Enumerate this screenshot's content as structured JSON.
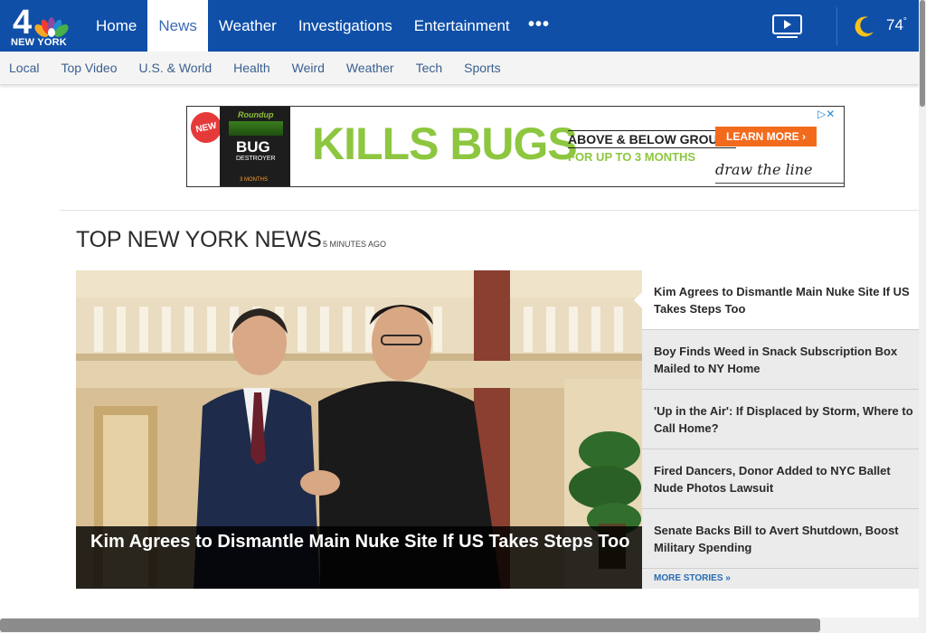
{
  "header": {
    "logo": {
      "number": "4",
      "city": "NEW YORK"
    },
    "nav": [
      {
        "label": "Home",
        "active": false
      },
      {
        "label": "News",
        "active": true
      },
      {
        "label": "Weather",
        "active": false
      },
      {
        "label": "Investigations",
        "active": false
      },
      {
        "label": "Entertainment",
        "active": false
      }
    ],
    "more_icon": "more-dots-icon",
    "video_icon": "video-play-icon",
    "weather": {
      "icon": "moon-icon",
      "temperature": "74",
      "unit": "°"
    }
  },
  "subnav": [
    "Local",
    "Top Video",
    "U.S. & World",
    "Health",
    "Weird",
    "Weather",
    "Tech",
    "Sports"
  ],
  "ad": {
    "badge": "NEW",
    "product_brand": "Roundup",
    "product_name": "BUG",
    "product_sub": "DESTROYER",
    "product_months": "3 MONTHS",
    "headline": "KILLS BUGS",
    "tagline": "ABOVE & BELOW GROUND",
    "subline": "FOR UP TO 3 MONTHS",
    "cta": "LEARN MORE ›",
    "slogan": "draw the line",
    "adchoices": "▷✕"
  },
  "section": {
    "title": "TOP NEW YORK NEWS",
    "updated": "5 MINUTES AGO"
  },
  "hero": {
    "headline": "Kim Agrees to Dismantle Main Nuke Site If US Takes Steps Too"
  },
  "stories": [
    {
      "title": "Kim Agrees to Dismantle Main Nuke Site If US Takes Steps Too",
      "active": true
    },
    {
      "title": "Boy Finds Weed in Snack Subscription Box Mailed to NY Home",
      "active": false
    },
    {
      "title": "'Up in the Air': If Displaced by Storm, Where to Call Home?",
      "active": false
    },
    {
      "title": "Fired Dancers, Donor Added to NYC Ballet Nude Photos Lawsuit",
      "active": false
    },
    {
      "title": "Senate Backs Bill to Avert Shutdown, Boost Military Spending",
      "active": false
    }
  ],
  "more_stories": "MORE STORIES »",
  "colors": {
    "nav_blue": "#0f4fa8",
    "link_blue": "#3a5f8f",
    "ad_green": "#8dc63f",
    "ad_orange": "#f26b1d"
  }
}
